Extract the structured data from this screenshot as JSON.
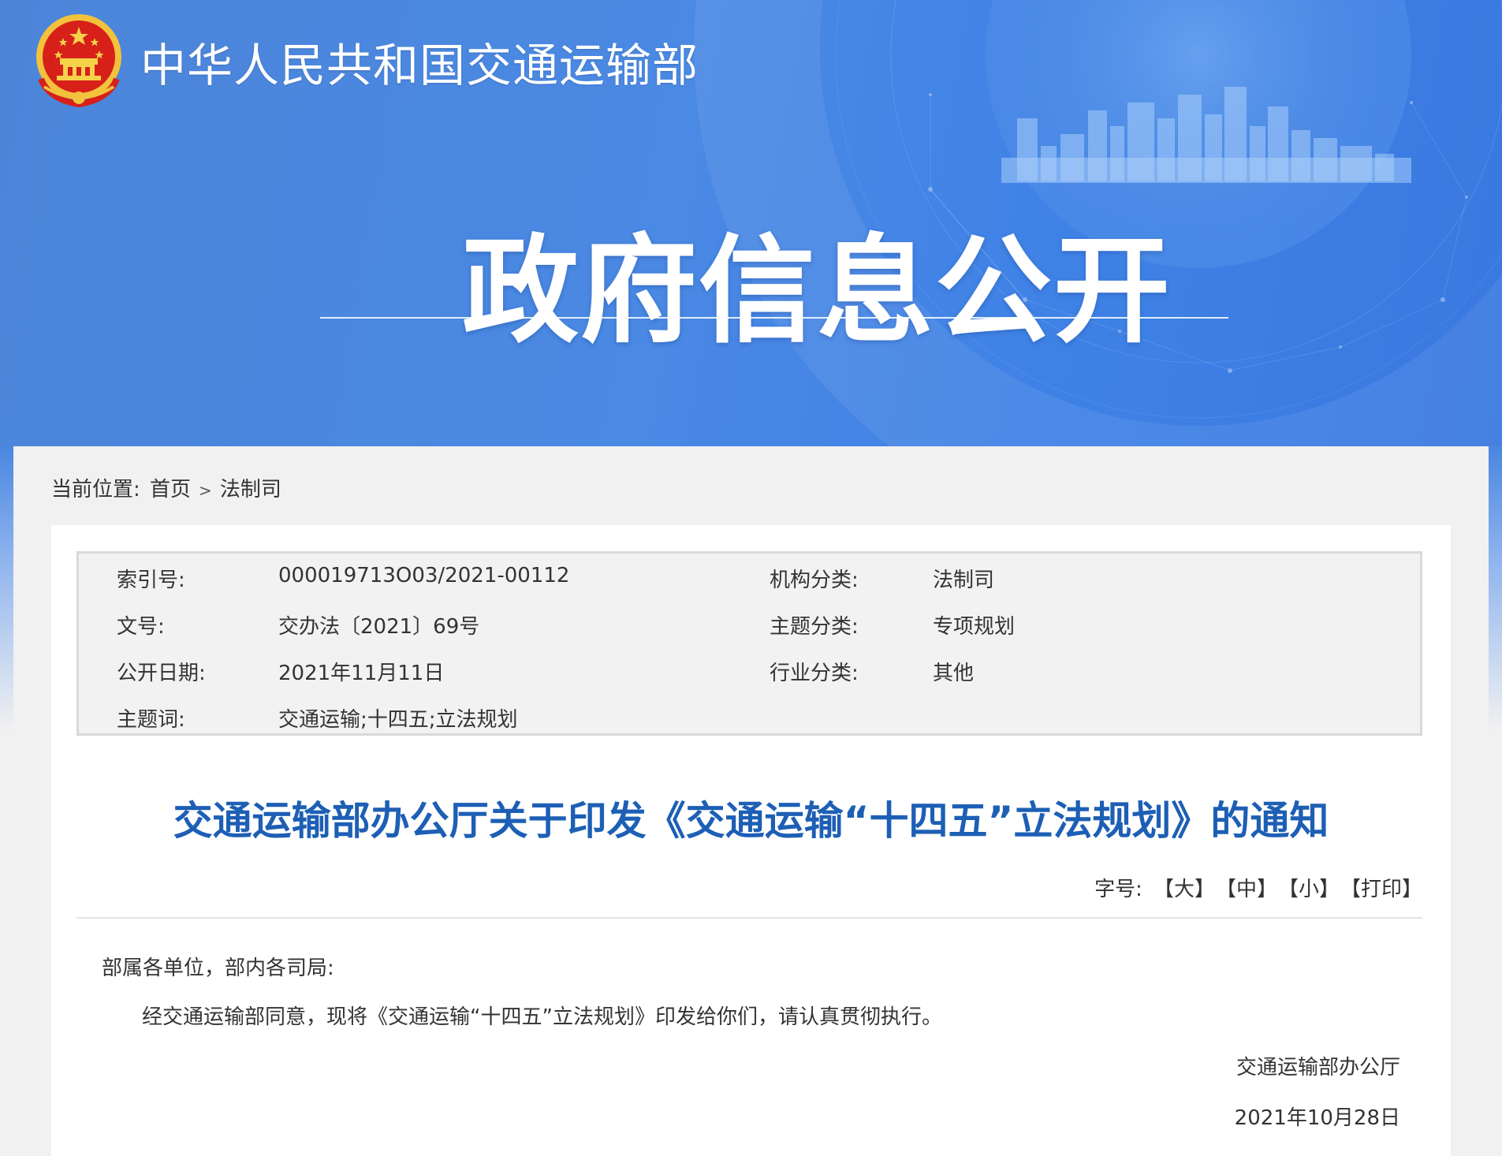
{
  "header": {
    "ministry_name": "中华人民共和国交通运输部",
    "section_title": "政府信息公开"
  },
  "breadcrumb": {
    "label": "当前位置:",
    "items": [
      "首页",
      "法制司"
    ],
    "separator": ">"
  },
  "metadata": {
    "rows": [
      {
        "label": "索引号:",
        "value": "000019713O03/2021-00112",
        "label2": "机构分类:",
        "value2": "法制司"
      },
      {
        "label": "文号:",
        "value": "交办法〔2021〕69号",
        "label2": "主题分类:",
        "value2": "专项规划"
      },
      {
        "label": "公开日期:",
        "value": "2021年11月11日",
        "label2": "行业分类:",
        "value2": "其他"
      },
      {
        "label": "主题词:",
        "value": "交通运输;十四五;立法规划",
        "label2": "",
        "value2": ""
      }
    ]
  },
  "document": {
    "title": "交通运输部办公厅关于印发《交通运输“十四五”立法规划》的通知",
    "fontsize_label": "字号:",
    "fontsize_options": [
      "【大】",
      "【中】",
      "【小】",
      "【打印】"
    ],
    "salutation": "部属各单位，部内各司局:",
    "body": "经交通运输部同意，现将《交通运输“十四五”立法规划》印发给你们，请认真贯彻执行。",
    "signature": "交通运输部办公厅",
    "date": "2021年10月28日"
  },
  "colors": {
    "banner": "#4a89e4",
    "title": "#1d5fb5",
    "emblem_red": "#d7201a",
    "emblem_gold": "#f2c23c"
  }
}
